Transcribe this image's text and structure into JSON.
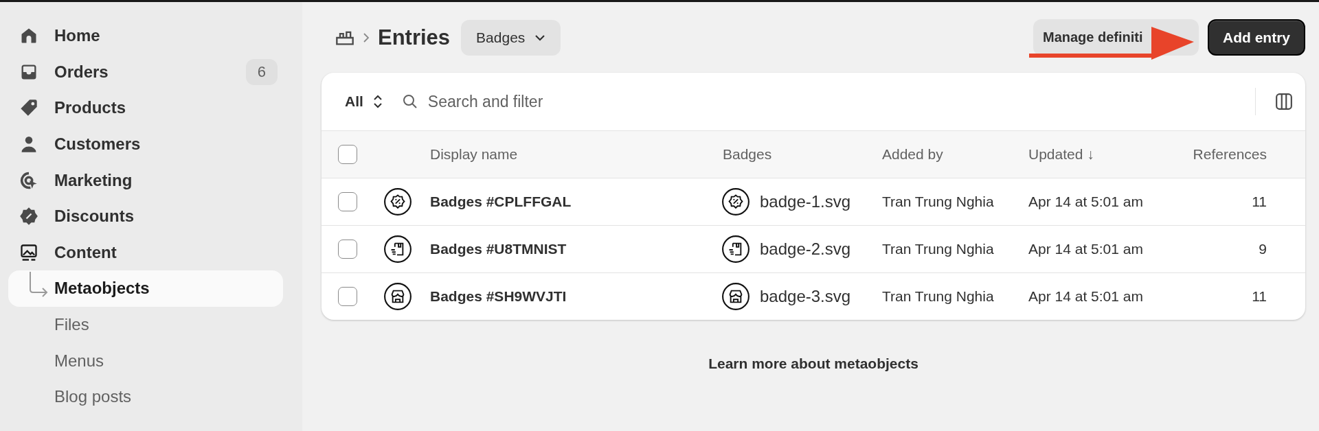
{
  "sidebar": {
    "items": [
      {
        "label": "Home",
        "selected": false
      },
      {
        "label": "Orders",
        "badge": "6",
        "selected": false
      },
      {
        "label": "Products",
        "selected": false
      },
      {
        "label": "Customers",
        "selected": false
      },
      {
        "label": "Marketing",
        "selected": false
      },
      {
        "label": "Discounts",
        "selected": false
      },
      {
        "label": "Content",
        "selected": false,
        "children": [
          {
            "label": "Metaobjects",
            "selected": true
          },
          {
            "label": "Files",
            "selected": false
          },
          {
            "label": "Menus",
            "selected": false
          },
          {
            "label": "Blog posts",
            "selected": false
          }
        ]
      }
    ]
  },
  "header": {
    "title": "Entries",
    "type_selector": "Badges",
    "buttons": [
      {
        "label": "Manage definiti",
        "kind": "secondary"
      },
      {
        "label": "Add entry",
        "kind": "primary"
      }
    ]
  },
  "table": {
    "filter": "All",
    "search": {
      "placeholder": "Search and filter"
    },
    "select_all": {
      "checked": false
    },
    "columns": [
      "Display name",
      "Badges",
      "Added by",
      "Updated ↓",
      "References"
    ],
    "rows": [
      {
        "kind": "discount",
        "checked": false,
        "name": "Badges #CPLFFGAL",
        "file": "badge-1.svg",
        "added_by": "Tran Trung Nghia",
        "updated": "Apr 14 at 5:01 am",
        "references": "11"
      },
      {
        "kind": "package",
        "checked": false,
        "name": "Badges #U8TMNIST",
        "file": "badge-2.svg",
        "added_by": "Tran Trung Nghia",
        "updated": "Apr 14 at 5:01 am",
        "references": "9"
      },
      {
        "kind": "store",
        "checked": false,
        "name": "Badges #SH9WVJTI",
        "file": "badge-3.svg",
        "added_by": "Tran Trung Nghia",
        "updated": "Apr 14 at 5:01 am",
        "references": "11"
      }
    ]
  },
  "footer_link": "Learn more about metaobjects"
}
